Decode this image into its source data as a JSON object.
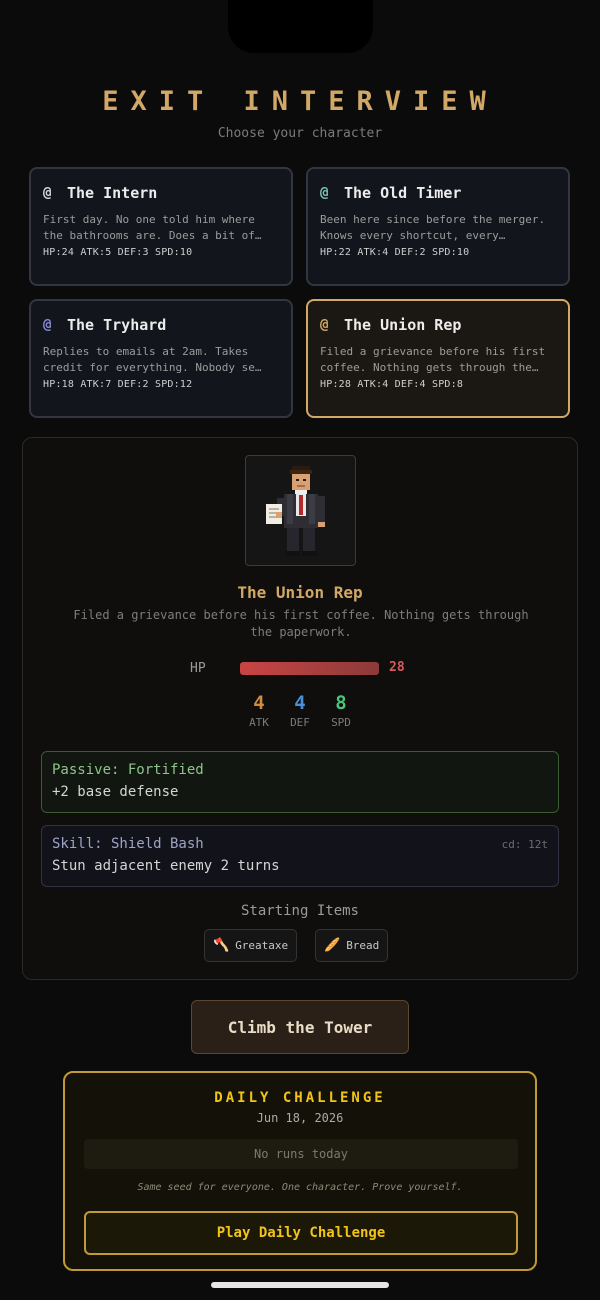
{
  "header": {
    "title": "EXIT INTERVIEW",
    "subtitle": "Choose your character"
  },
  "characters": [
    {
      "icon": "@",
      "icon_color": "#d9d9d9",
      "name": "The Intern",
      "desc": "First day. No one told him where the bathrooms are. Does a bit of…",
      "stats": "HP:24 ATK:5 DEF:3 SPD:10"
    },
    {
      "icon": "@",
      "icon_color": "#7cc7b2",
      "name": "The Old Timer",
      "desc": "Been here since before the merger. Knows every shortcut, every…",
      "stats": "HP:22 ATK:4 DEF:2 SPD:10"
    },
    {
      "icon": "@",
      "icon_color": "#8a8ad6",
      "name": "The Tryhard",
      "desc": "Replies to emails at 2am. Takes credit for everything. Nobody se…",
      "stats": "HP:18 ATK:7 DEF:2 SPD:12"
    },
    {
      "icon": "@",
      "icon_color": "#d2a867",
      "name": "The Union Rep",
      "desc": "Filed a grievance before his first coffee. Nothing gets through the…",
      "stats": "HP:28 ATK:4 DEF:4 SPD:8",
      "selected": true
    }
  ],
  "detail": {
    "portrait_icon": "businessman-pixel-portrait",
    "name": "The Union Rep",
    "desc": "Filed a grievance before his first coffee. Nothing gets through the paperwork.",
    "hp_label": "HP",
    "hp_value": "28",
    "hp_fraction": 1.0,
    "stats": [
      {
        "value": "4",
        "label": "ATK",
        "color": "#d28a3c"
      },
      {
        "value": "4",
        "label": "DEF",
        "color": "#4a90d9"
      },
      {
        "value": "8",
        "label": "SPD",
        "color": "#4bc47a"
      }
    ],
    "passive": {
      "title": "Passive: Fortified",
      "desc": "+2 base defense"
    },
    "skill": {
      "title": "Skill: Shield Bash",
      "cooldown": "cd: 12t",
      "desc": "Stun adjacent enemy 2 turns"
    },
    "items_title": "Starting Items",
    "items": [
      {
        "icon": "🪓",
        "label": "Greataxe"
      },
      {
        "icon": "🥖",
        "label": "Bread"
      }
    ]
  },
  "climb_button": "Climb the Tower",
  "daily": {
    "title": "DAILY CHALLENGE",
    "date": "Jun 18, 2026",
    "runs": "No runs today",
    "note": "Same seed for everyone. One character. Prove yourself.",
    "button": "Play Daily Challenge"
  }
}
